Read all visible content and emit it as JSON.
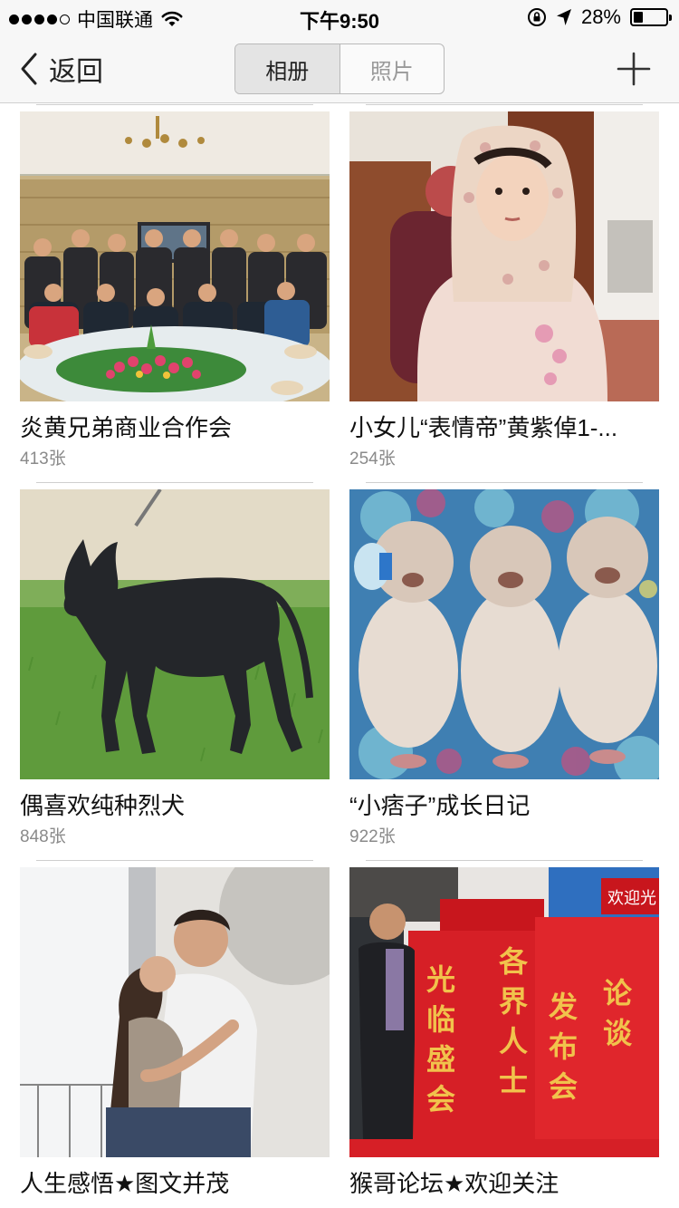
{
  "status_bar": {
    "carrier": "中国联通",
    "time": "下午9:50",
    "battery": "28%",
    "battery_level": 0.28,
    "signal_bars_filled": 4,
    "signal_bars_total": 5,
    "icons": [
      "wifi-icon",
      "rotation-lock-icon",
      "location-arrow-icon",
      "battery-icon"
    ]
  },
  "nav": {
    "back_label": "返回",
    "tabs": [
      {
        "label": "相册",
        "active": true
      },
      {
        "label": "照片",
        "active": false
      }
    ],
    "add_icon": "plus-icon"
  },
  "albums": [
    {
      "title": "炎黄兄弟商业合作会",
      "count": "413张",
      "photo": "group-banquet"
    },
    {
      "title": "小女儿“表情帝”黄紫倬1-...",
      "count": "254张",
      "photo": "girl-in-headscarf"
    },
    {
      "title": "偶喜欢纯种烈犬",
      "count": "848张",
      "photo": "black-dog-on-grass"
    },
    {
      "title": "“小痞子”成长日记",
      "count": "922张",
      "photo": "three-puppies"
    },
    {
      "title": "人生感悟★图文并茂",
      "count": "",
      "photo": "couple-kissing"
    },
    {
      "title": "猴哥论坛★欢迎关注",
      "count": "",
      "photo": "red-banner-event"
    }
  ],
  "photo_text": {
    "banner_welcome": "欢迎光",
    "banner_col1": "光临盛会",
    "banner_col2": "各界人士",
    "banner_col3": "发布会",
    "banner_col4": "论谈"
  },
  "colors": {
    "bar_bg": "#f7f7f7",
    "seg_active": "#e4e4e4",
    "seg_inactive_text": "#9a9a9a",
    "count_text": "#8a8a8a"
  }
}
